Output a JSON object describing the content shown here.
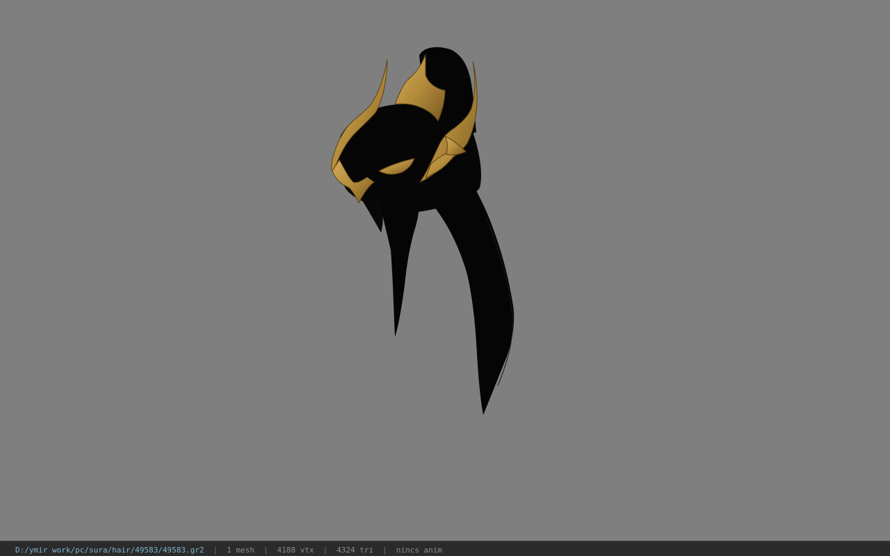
{
  "viewport": {
    "background_color": "#7f7f7f",
    "model": {
      "icon": "hair-mesh-model",
      "hair_color": "#050505",
      "ornament_color": "#b48c3c"
    }
  },
  "status_bar": {
    "file_path": "D:/ymir work/pc/sura/hair/49583/49583.gr2",
    "separator": "|",
    "mesh_count": "1 mesh",
    "vertex_count": "4188 vtx",
    "triangle_count": "4324 tri",
    "anim_status": "nincs anim"
  }
}
